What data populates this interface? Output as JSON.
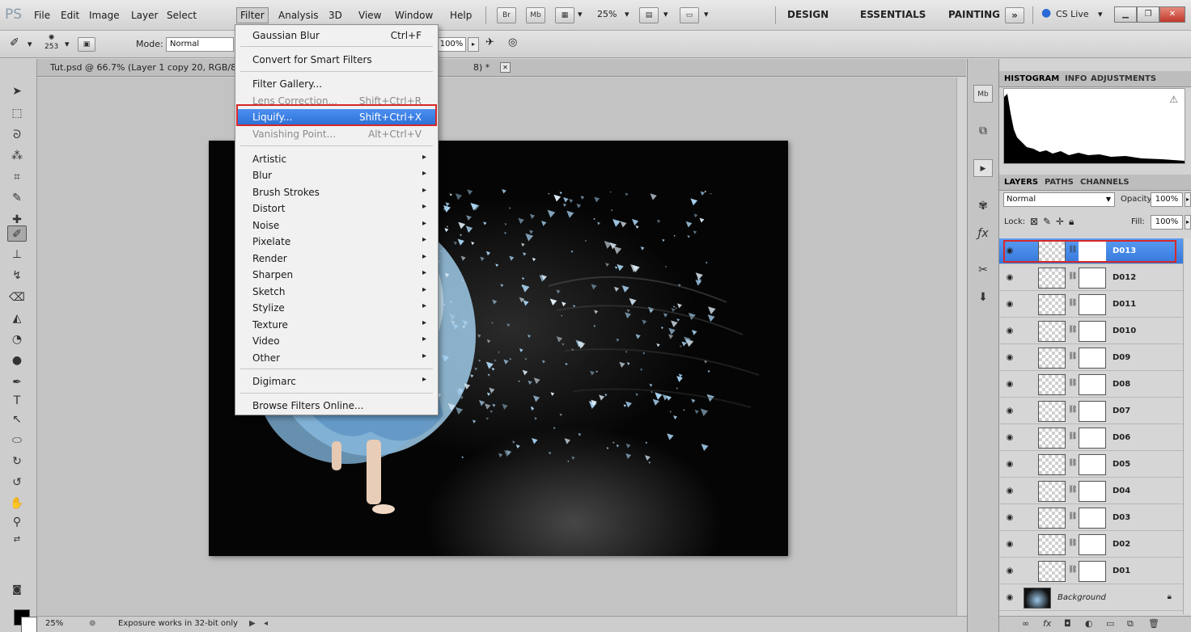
{
  "menubar": {
    "logo": "PS",
    "items": [
      "File",
      "Edit",
      "Image",
      "Layer",
      "Select",
      "Filter",
      "Analysis",
      "3D",
      "View",
      "Window",
      "Help"
    ],
    "bridge_label": "Br",
    "minibridge_label": "Mb",
    "zoom_level": "25%",
    "workspaces": [
      "DESIGN",
      "ESSENTIALS",
      "PAINTING"
    ],
    "more_workspaces": "»",
    "cs_live": "CS Live"
  },
  "options": {
    "brush_size": "253",
    "mode_label": "Mode:",
    "mode_value": "Normal",
    "flow_value": "100%"
  },
  "document": {
    "tab_title": "Tut.psd @ 66.7% (Layer 1 copy 20, RGB/8",
    "tab_title_tail": "8) *",
    "close_glyph": "✕"
  },
  "filter_menu": {
    "items": [
      {
        "label": "Gaussian Blur",
        "shortcut": "Ctrl+F"
      },
      {
        "label": "Convert for Smart Filters"
      },
      {
        "label": "Filter Gallery..."
      },
      {
        "label": "Lens Correction...",
        "shortcut": "Shift+Ctrl+R"
      },
      {
        "label": "Liquify...",
        "shortcut": "Shift+Ctrl+X"
      },
      {
        "label": "Vanishing Point...",
        "shortcut": "Alt+Ctrl+V"
      },
      {
        "label": "Artistic"
      },
      {
        "label": "Blur"
      },
      {
        "label": "Brush Strokes"
      },
      {
        "label": "Distort"
      },
      {
        "label": "Noise"
      },
      {
        "label": "Pixelate"
      },
      {
        "label": "Render"
      },
      {
        "label": "Sharpen"
      },
      {
        "label": "Sketch"
      },
      {
        "label": "Stylize"
      },
      {
        "label": "Texture"
      },
      {
        "label": "Video"
      },
      {
        "label": "Other"
      },
      {
        "label": "Digimarc"
      },
      {
        "label": "Browse Filters Online..."
      }
    ],
    "submenu_arrow": "▸",
    "highlighted_item": "Liquify..."
  },
  "panels": {
    "top_tabs": [
      "HISTOGRAM",
      "INFO",
      "ADJUSTMENTS"
    ],
    "histogram_warning": "⚠",
    "layer_tabs": [
      "LAYERS",
      "PATHS",
      "CHANNELS"
    ],
    "blend_mode": "Normal",
    "opacity_label": "Opacity:",
    "opacity_value": "100%",
    "lock_label": "Lock:",
    "fill_label": "Fill:",
    "fill_value": "100%",
    "layers": [
      {
        "name": "D013",
        "selected": true
      },
      {
        "name": "D012"
      },
      {
        "name": "D011"
      },
      {
        "name": "D010"
      },
      {
        "name": "D09"
      },
      {
        "name": "D08"
      },
      {
        "name": "D07"
      },
      {
        "name": "D06"
      },
      {
        "name": "D05"
      },
      {
        "name": "D04"
      },
      {
        "name": "D03"
      },
      {
        "name": "D02"
      },
      {
        "name": "D01"
      }
    ],
    "background_layer": "Background"
  },
  "dock": {
    "mini_bridge": "Mb"
  },
  "statusbar": {
    "zoom": "25%",
    "info": "Exposure works in 32-bit only"
  },
  "colors": {
    "highlight_blue": "#3578dc",
    "annotation_red": "#d62828"
  }
}
